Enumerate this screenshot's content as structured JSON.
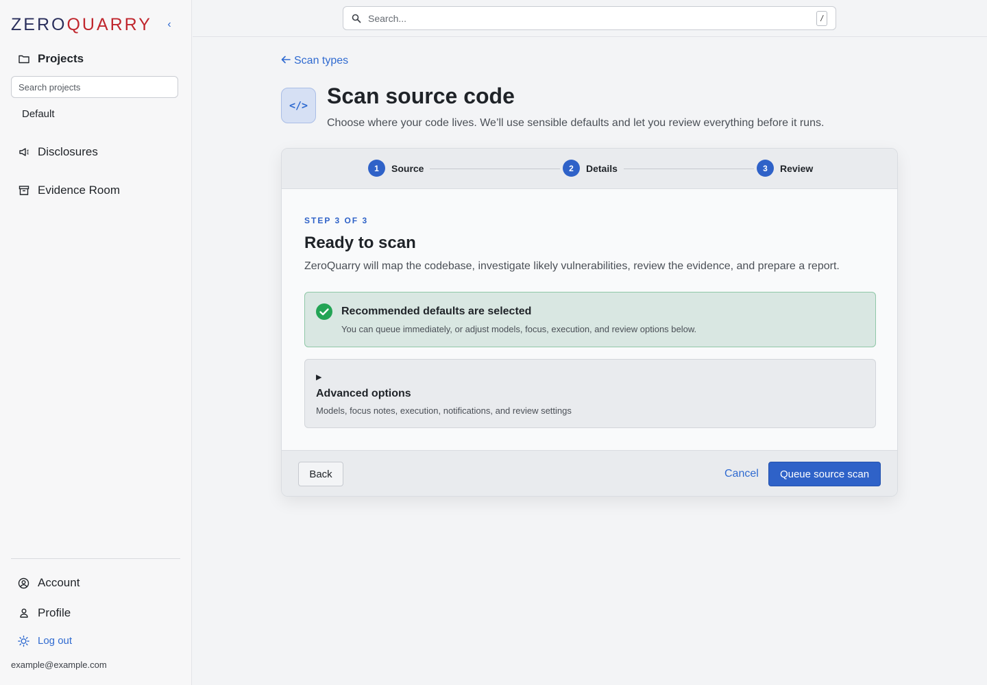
{
  "brand": {
    "name_part1": "ZERO",
    "name_part2": "QUARRY"
  },
  "sidebar": {
    "collapse_icon": "chevron-left-icon",
    "projects_label": "Projects",
    "project_search_placeholder": "Search projects",
    "projects": [
      "Default"
    ],
    "nav": [
      {
        "label": "Disclosures",
        "icon": "megaphone-icon"
      },
      {
        "label": "Evidence Room",
        "icon": "archive-icon"
      }
    ],
    "bottom": [
      {
        "label": "Account",
        "icon": "user-circle-icon"
      },
      {
        "label": "Profile",
        "icon": "user-icon"
      }
    ],
    "logout_label": "Log out",
    "user_email": "example@example.com"
  },
  "topbar": {
    "search_placeholder": "Search...",
    "shortcut_key": "/"
  },
  "main": {
    "back_link": "Scan types",
    "icon_label": "</>",
    "title": "Scan source code",
    "subtitle": "Choose where your code lives. We’ll use sensible defaults and let you review everything before it runs."
  },
  "wizard": {
    "steps": [
      {
        "num": "1",
        "label": "Source"
      },
      {
        "num": "2",
        "label": "Details"
      },
      {
        "num": "3",
        "label": "Review"
      }
    ],
    "eyebrow": "STEP 3 OF 3",
    "title": "Ready to scan",
    "description": "ZeroQuarry will map the codebase, investigate likely vulnerabilities, review the evidence, and prepare a report.",
    "notice": {
      "title": "Recommended defaults are selected",
      "body": "You can queue immediately, or adjust models, focus, execution, and review options below."
    },
    "advanced": {
      "caret": "▶",
      "title": "Advanced options",
      "body": "Models, focus notes, execution, notifications, and review settings"
    },
    "footer": {
      "back_label": "Back",
      "cancel_label": "Cancel",
      "queue_label": "Queue source scan"
    }
  },
  "colors": {
    "accent": "#2f62c8",
    "link": "#2f6ad0",
    "success": "#23a455",
    "brand_red": "#c0262d",
    "brand_navy": "#2a2f5c"
  }
}
